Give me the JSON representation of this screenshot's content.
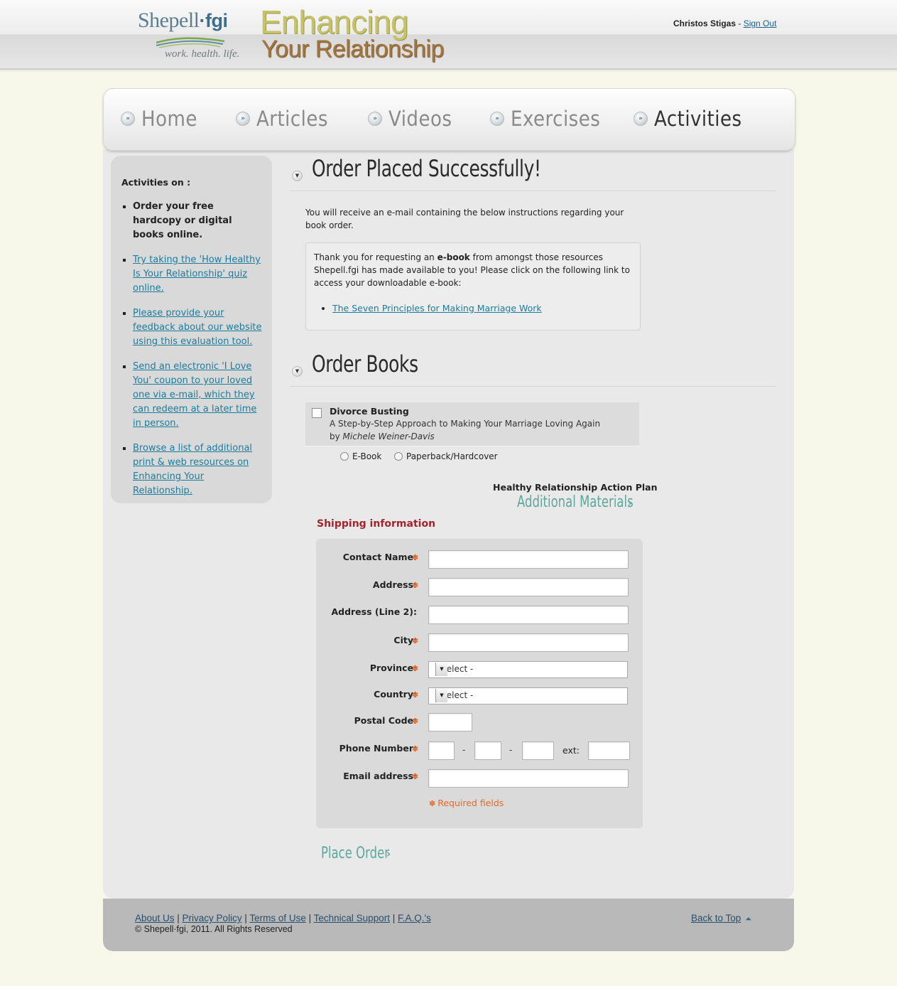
{
  "header": {
    "logo_name": "Shepell",
    "logo_dot": "·",
    "logo_fgi": "fgi",
    "logo_tagline": "work. health. life.",
    "title_line1": "Enhancing",
    "title_line2": "Your Relationship",
    "user_name": "Christos Stigas",
    "separator": " - ",
    "sign_out": "Sign Out"
  },
  "nav": {
    "items": [
      {
        "label": "Home",
        "active": false
      },
      {
        "label": "Articles",
        "active": false
      },
      {
        "label": "Videos",
        "active": false
      },
      {
        "label": "Exercises",
        "active": false
      },
      {
        "label": "Activities",
        "active": true
      }
    ],
    "bullet_glyph": "»"
  },
  "sidebar": {
    "title": "Activities on :",
    "items": [
      {
        "label": "Order your free hardcopy or digital books online.",
        "current": true
      },
      {
        "label": "Try taking the 'How Healthy Is Your Relationship' quiz online."
      },
      {
        "label": "Please provide your feedback about our website using this evaluation tool."
      },
      {
        "label": "Send an electronic 'I Love You' coupon to your loved one via e-mail, which they can redeem at a later time in person."
      },
      {
        "label": "Browse a list of additional print & web resources on Enhancing Your Relationship."
      }
    ]
  },
  "order_success": {
    "title": "Order Placed Successfully!",
    "intro": "You will receive an e-mail containing the below instructions regarding your book order.",
    "msg_part1": "Thank you for requesting an ",
    "msg_bold": "e-book",
    "msg_part2": " from amongst those resources Shepell.fgi has made available to you! Please click on the following link to access your downloadable e-book:",
    "ebook_link": "The Seven Principles for Making Marriage Work"
  },
  "order_books": {
    "title": "Order Books",
    "book": {
      "title": "Divorce Busting",
      "subtitle": "A Step-by-Step Approach to Making Your Marriage Loving Again",
      "by": "by ",
      "author": "Michele Weiner-Davis",
      "checked": false
    },
    "formats": [
      "E-Book",
      "Paperback/Hardcover"
    ],
    "plan_label": "Healthy Relationship Action Plan",
    "additional_materials": "Additional Materials",
    "arrow_glyph": "›"
  },
  "shipping": {
    "title": "Shipping information",
    "fields": {
      "contact_name": {
        "label": "Contact Name:",
        "value": "",
        "required": true
      },
      "address": {
        "label": "Address:",
        "value": "",
        "required": true
      },
      "address2": {
        "label": "Address (Line 2):",
        "value": "",
        "required": false
      },
      "city": {
        "label": "City:",
        "value": "",
        "required": true
      },
      "province": {
        "label": "Province:",
        "value": "- Select -",
        "required": true
      },
      "country": {
        "label": "Country:",
        "value": "- Select -",
        "required": true
      },
      "postal_code": {
        "label": "Postal Code:",
        "value": "",
        "required": true
      },
      "phone": {
        "label": "Phone Number:",
        "value": "",
        "required": true,
        "separator": "-",
        "ext_label": "ext:"
      },
      "email": {
        "label": "Email address:",
        "value": "",
        "required": true
      }
    },
    "required_star": "✽",
    "required_note": "Required fields",
    "place_order": "Place Order"
  },
  "footer": {
    "links": [
      "About Us",
      "Privacy Policy",
      "Terms of Use",
      "Technical Support",
      "F.A.Q.'s"
    ],
    "link_separator": " | ",
    "copyright": "© Shepell·fgi, 2011. All Rights Reserved",
    "back_to_top": "Back to Top",
    "back_to_top_icon": "⏶"
  },
  "colors": {
    "page_bg": "#f8f8ea",
    "panel_bg": "#e9e9e9",
    "link": "#1b7d9e",
    "accent_green": "#5fa69b",
    "shipping_title": "#a3242e",
    "required": "#e06a2a",
    "footer_bg": "#b9b9b9"
  }
}
